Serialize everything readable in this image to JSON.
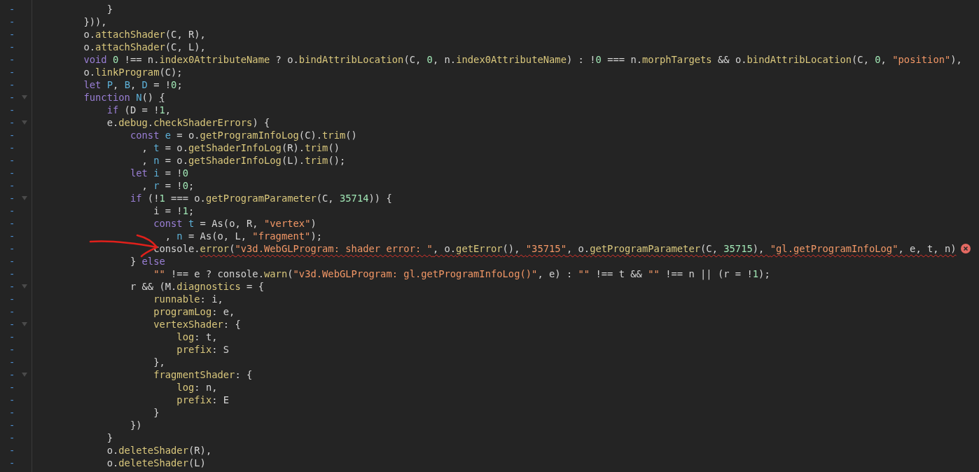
{
  "editor": {
    "lines": [
      {
        "marker": "-",
        "foldable": false,
        "spans": [
          {
            "text": "            }",
            "kind": "plain"
          }
        ]
      },
      {
        "marker": "-",
        "foldable": false,
        "spans": [
          {
            "text": "        })),",
            "kind": "plain"
          }
        ]
      },
      {
        "marker": "-",
        "foldable": false,
        "spans": [
          {
            "text": "        o.",
            "kind": "plain"
          },
          {
            "text": "attachShader",
            "kind": "property"
          },
          {
            "text": "(C, R),",
            "kind": "plain"
          }
        ]
      },
      {
        "marker": "-",
        "foldable": false,
        "spans": [
          {
            "text": "        o.",
            "kind": "plain"
          },
          {
            "text": "attachShader",
            "kind": "property"
          },
          {
            "text": "(C, L),",
            "kind": "plain"
          }
        ]
      },
      {
        "marker": "-",
        "foldable": false,
        "spans": [
          {
            "text": "        void",
            "kind": "keyword"
          },
          {
            "text": " 0",
            "kind": "number"
          },
          {
            "text": " !== n.",
            "kind": "plain"
          },
          {
            "text": "index0AttributeName",
            "kind": "property"
          },
          {
            "text": " ? o.",
            "kind": "plain"
          },
          {
            "text": "bindAttribLocation",
            "kind": "property"
          },
          {
            "text": "(C, ",
            "kind": "plain"
          },
          {
            "text": "0",
            "kind": "number"
          },
          {
            "text": ", n.",
            "kind": "plain"
          },
          {
            "text": "index0AttributeName",
            "kind": "property"
          },
          {
            "text": ") : !",
            "kind": "plain"
          },
          {
            "text": "0",
            "kind": "number"
          },
          {
            "text": " === n.",
            "kind": "plain"
          },
          {
            "text": "morphTargets",
            "kind": "property"
          },
          {
            "text": " && o.",
            "kind": "plain"
          },
          {
            "text": "bindAttribLocation",
            "kind": "property"
          },
          {
            "text": "(C, ",
            "kind": "plain"
          },
          {
            "text": "0",
            "kind": "number"
          },
          {
            "text": ", ",
            "kind": "plain"
          },
          {
            "text": "\"position\"",
            "kind": "string"
          },
          {
            "text": "),",
            "kind": "plain"
          }
        ]
      },
      {
        "marker": "-",
        "foldable": false,
        "spans": [
          {
            "text": "        o.",
            "kind": "plain"
          },
          {
            "text": "linkProgram",
            "kind": "property"
          },
          {
            "text": "(C);",
            "kind": "plain"
          }
        ]
      },
      {
        "marker": "-",
        "foldable": false,
        "spans": [
          {
            "text": "        let",
            "kind": "keyword"
          },
          {
            "text": " P",
            "kind": "variable"
          },
          {
            "text": ", ",
            "kind": "plain"
          },
          {
            "text": "B",
            "kind": "variable"
          },
          {
            "text": ", ",
            "kind": "plain"
          },
          {
            "text": "D",
            "kind": "variable"
          },
          {
            "text": " = !",
            "kind": "plain"
          },
          {
            "text": "0",
            "kind": "number"
          },
          {
            "text": ";",
            "kind": "plain"
          }
        ]
      },
      {
        "marker": "-",
        "foldable": true,
        "spans": [
          {
            "text": "        function",
            "kind": "keyword"
          },
          {
            "text": " N",
            "kind": "variable"
          },
          {
            "text": "() ",
            "kind": "plain"
          },
          {
            "text": "{",
            "kind": "bracket"
          }
        ]
      },
      {
        "marker": "-",
        "foldable": false,
        "spans": [
          {
            "text": "            if",
            "kind": "keyword"
          },
          {
            "text": " (D = !",
            "kind": "plain"
          },
          {
            "text": "1",
            "kind": "number"
          },
          {
            "text": ",",
            "kind": "plain"
          }
        ]
      },
      {
        "marker": "-",
        "foldable": true,
        "spans": [
          {
            "text": "            e.",
            "kind": "plain"
          },
          {
            "text": "debug",
            "kind": "property"
          },
          {
            "text": ".",
            "kind": "plain"
          },
          {
            "text": "checkShaderErrors",
            "kind": "property"
          },
          {
            "text": ") {",
            "kind": "plain"
          }
        ]
      },
      {
        "marker": "-",
        "foldable": false,
        "spans": [
          {
            "text": "                const",
            "kind": "keyword"
          },
          {
            "text": " e",
            "kind": "variable"
          },
          {
            "text": " = o.",
            "kind": "plain"
          },
          {
            "text": "getProgramInfoLog",
            "kind": "property"
          },
          {
            "text": "(C).",
            "kind": "plain"
          },
          {
            "text": "trim",
            "kind": "property"
          },
          {
            "text": "()",
            "kind": "plain"
          }
        ]
      },
      {
        "marker": "-",
        "foldable": false,
        "spans": [
          {
            "text": "                  , ",
            "kind": "plain"
          },
          {
            "text": "t",
            "kind": "variable"
          },
          {
            "text": " = o.",
            "kind": "plain"
          },
          {
            "text": "getShaderInfoLog",
            "kind": "property"
          },
          {
            "text": "(R).",
            "kind": "plain"
          },
          {
            "text": "trim",
            "kind": "property"
          },
          {
            "text": "()",
            "kind": "plain"
          }
        ]
      },
      {
        "marker": "-",
        "foldable": false,
        "spans": [
          {
            "text": "                  , ",
            "kind": "plain"
          },
          {
            "text": "n",
            "kind": "variable"
          },
          {
            "text": " = o.",
            "kind": "plain"
          },
          {
            "text": "getShaderInfoLog",
            "kind": "property"
          },
          {
            "text": "(L).",
            "kind": "plain"
          },
          {
            "text": "trim",
            "kind": "property"
          },
          {
            "text": "();",
            "kind": "plain"
          }
        ]
      },
      {
        "marker": "-",
        "foldable": false,
        "spans": [
          {
            "text": "                let",
            "kind": "keyword"
          },
          {
            "text": " i",
            "kind": "variable"
          },
          {
            "text": " = !",
            "kind": "plain"
          },
          {
            "text": "0",
            "kind": "number"
          }
        ]
      },
      {
        "marker": "-",
        "foldable": false,
        "spans": [
          {
            "text": "                  , ",
            "kind": "plain"
          },
          {
            "text": "r",
            "kind": "variable"
          },
          {
            "text": " = !",
            "kind": "plain"
          },
          {
            "text": "0",
            "kind": "number"
          },
          {
            "text": ";",
            "kind": "plain"
          }
        ]
      },
      {
        "marker": "-",
        "foldable": true,
        "spans": [
          {
            "text": "                if",
            "kind": "keyword"
          },
          {
            "text": " (!",
            "kind": "plain"
          },
          {
            "text": "1",
            "kind": "number"
          },
          {
            "text": " === o.",
            "kind": "plain"
          },
          {
            "text": "getProgramParameter",
            "kind": "property"
          },
          {
            "text": "(C, ",
            "kind": "plain"
          },
          {
            "text": "35714",
            "kind": "number"
          },
          {
            "text": ")) {",
            "kind": "plain"
          }
        ]
      },
      {
        "marker": "-",
        "foldable": false,
        "spans": [
          {
            "text": "                    i = !",
            "kind": "plain"
          },
          {
            "text": "1",
            "kind": "number"
          },
          {
            "text": ";",
            "kind": "plain"
          }
        ]
      },
      {
        "marker": "-",
        "foldable": false,
        "spans": [
          {
            "text": "                    const",
            "kind": "keyword"
          },
          {
            "text": " t",
            "kind": "variable"
          },
          {
            "text": " = As(o, R, ",
            "kind": "plain"
          },
          {
            "text": "\"vertex\"",
            "kind": "string"
          },
          {
            "text": ")",
            "kind": "plain"
          }
        ]
      },
      {
        "marker": "-",
        "foldable": false,
        "spans": [
          {
            "text": "                      , ",
            "kind": "plain"
          },
          {
            "text": "n",
            "kind": "variable"
          },
          {
            "text": " = As(o, L, ",
            "kind": "plain"
          },
          {
            "text": "\"fragment\"",
            "kind": "string"
          },
          {
            "text": ");",
            "kind": "plain"
          }
        ]
      },
      {
        "marker": "-",
        "foldable": false,
        "spans": [
          {
            "text": "                    console.",
            "kind": "plain"
          }
        ],
        "error_spans": [
          {
            "text": "error",
            "kind": "property"
          },
          {
            "text": "(",
            "kind": "plain"
          },
          {
            "text": "\"v3d.WebGLProgram: shader error: \"",
            "kind": "string"
          },
          {
            "text": ", o.",
            "kind": "plain"
          },
          {
            "text": "getError",
            "kind": "property"
          },
          {
            "text": "(), ",
            "kind": "plain"
          },
          {
            "text": "\"35715\"",
            "kind": "string"
          },
          {
            "text": ", o.",
            "kind": "plain"
          },
          {
            "text": "getProgramParameter",
            "kind": "property"
          },
          {
            "text": "(C, ",
            "kind": "plain"
          },
          {
            "text": "35715",
            "kind": "number"
          },
          {
            "text": "), ",
            "kind": "plain"
          },
          {
            "text": "\"gl.getProgramInfoLog\"",
            "kind": "string"
          },
          {
            "text": ", e, t, n)",
            "kind": "plain"
          }
        ]
      },
      {
        "marker": "-",
        "foldable": false,
        "spans": [
          {
            "text": "                } ",
            "kind": "plain"
          },
          {
            "text": "else",
            "kind": "keyword"
          }
        ]
      },
      {
        "marker": "-",
        "foldable": false,
        "spans": [
          {
            "text": "                    \"\"",
            "kind": "string"
          },
          {
            "text": " !== e ? console.",
            "kind": "plain"
          },
          {
            "text": "warn",
            "kind": "property"
          },
          {
            "text": "(",
            "kind": "plain"
          },
          {
            "text": "\"v3d.WebGLProgram: gl.getProgramInfoLog()\"",
            "kind": "string"
          },
          {
            "text": ", e) : ",
            "kind": "plain"
          },
          {
            "text": "\"\"",
            "kind": "string"
          },
          {
            "text": " !== t && ",
            "kind": "plain"
          },
          {
            "text": "\"\"",
            "kind": "string"
          },
          {
            "text": " !== n || (r = !",
            "kind": "plain"
          },
          {
            "text": "1",
            "kind": "number"
          },
          {
            "text": ");",
            "kind": "plain"
          }
        ]
      },
      {
        "marker": "-",
        "foldable": true,
        "spans": [
          {
            "text": "                r && (M.",
            "kind": "plain"
          },
          {
            "text": "diagnostics",
            "kind": "property"
          },
          {
            "text": " = {",
            "kind": "plain"
          }
        ]
      },
      {
        "marker": "-",
        "foldable": false,
        "spans": [
          {
            "text": "                    runnable",
            "kind": "property"
          },
          {
            "text": ": i,",
            "kind": "plain"
          }
        ]
      },
      {
        "marker": "-",
        "foldable": false,
        "spans": [
          {
            "text": "                    programLog",
            "kind": "property"
          },
          {
            "text": ": e,",
            "kind": "plain"
          }
        ]
      },
      {
        "marker": "-",
        "foldable": true,
        "spans": [
          {
            "text": "                    vertexShader",
            "kind": "property"
          },
          {
            "text": ": {",
            "kind": "plain"
          }
        ]
      },
      {
        "marker": "-",
        "foldable": false,
        "spans": [
          {
            "text": "                        log",
            "kind": "property"
          },
          {
            "text": ": t,",
            "kind": "plain"
          }
        ]
      },
      {
        "marker": "-",
        "foldable": false,
        "spans": [
          {
            "text": "                        prefix",
            "kind": "property"
          },
          {
            "text": ": S",
            "kind": "plain"
          }
        ]
      },
      {
        "marker": "-",
        "foldable": false,
        "spans": [
          {
            "text": "                    },",
            "kind": "plain"
          }
        ]
      },
      {
        "marker": "-",
        "foldable": true,
        "spans": [
          {
            "text": "                    fragmentShader",
            "kind": "property"
          },
          {
            "text": ": {",
            "kind": "plain"
          }
        ]
      },
      {
        "marker": "-",
        "foldable": false,
        "spans": [
          {
            "text": "                        log",
            "kind": "property"
          },
          {
            "text": ": n,",
            "kind": "plain"
          }
        ]
      },
      {
        "marker": "-",
        "foldable": false,
        "spans": [
          {
            "text": "                        prefix",
            "kind": "property"
          },
          {
            "text": ": E",
            "kind": "plain"
          }
        ]
      },
      {
        "marker": "-",
        "foldable": false,
        "spans": [
          {
            "text": "                    }",
            "kind": "plain"
          }
        ]
      },
      {
        "marker": "-",
        "foldable": false,
        "spans": [
          {
            "text": "                })",
            "kind": "plain"
          }
        ]
      },
      {
        "marker": "-",
        "foldable": false,
        "spans": [
          {
            "text": "            }",
            "kind": "plain"
          }
        ]
      },
      {
        "marker": "-",
        "foldable": false,
        "spans": [
          {
            "text": "            o.",
            "kind": "plain"
          },
          {
            "text": "deleteShader",
            "kind": "property"
          },
          {
            "text": "(R),",
            "kind": "plain"
          }
        ]
      },
      {
        "marker": "-",
        "foldable": false,
        "spans": [
          {
            "text": "            o.",
            "kind": "plain"
          },
          {
            "text": "deleteShader",
            "kind": "property"
          },
          {
            "text": "(L)",
            "kind": "plain"
          }
        ]
      }
    ]
  }
}
